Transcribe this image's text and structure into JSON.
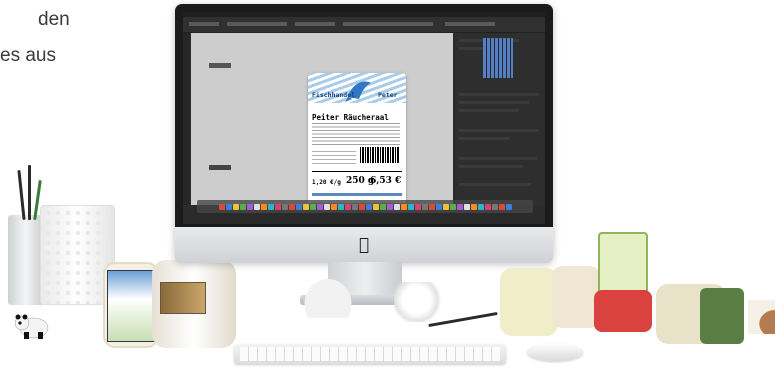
{
  "background_text": {
    "line1": "den",
    "line2": "es aus"
  },
  "label": {
    "shop_name": "Fischhandel",
    "shop_owner": "Peter",
    "product_name": "Peiter Räucheraal",
    "unit_price": "1,20 €/g",
    "weight": "250 g",
    "price": "6,53 €"
  },
  "icons": {
    "apple": "apple-logo",
    "fish": "fish-icon",
    "dock": "dock-icons",
    "barcode": "barcode-icon"
  },
  "colors": {
    "label_blue": "#11427a",
    "wave_blue": "#9ec6e8",
    "screen_dark": "#2b2b2b",
    "canvas_gray": "#cdcdcd"
  }
}
